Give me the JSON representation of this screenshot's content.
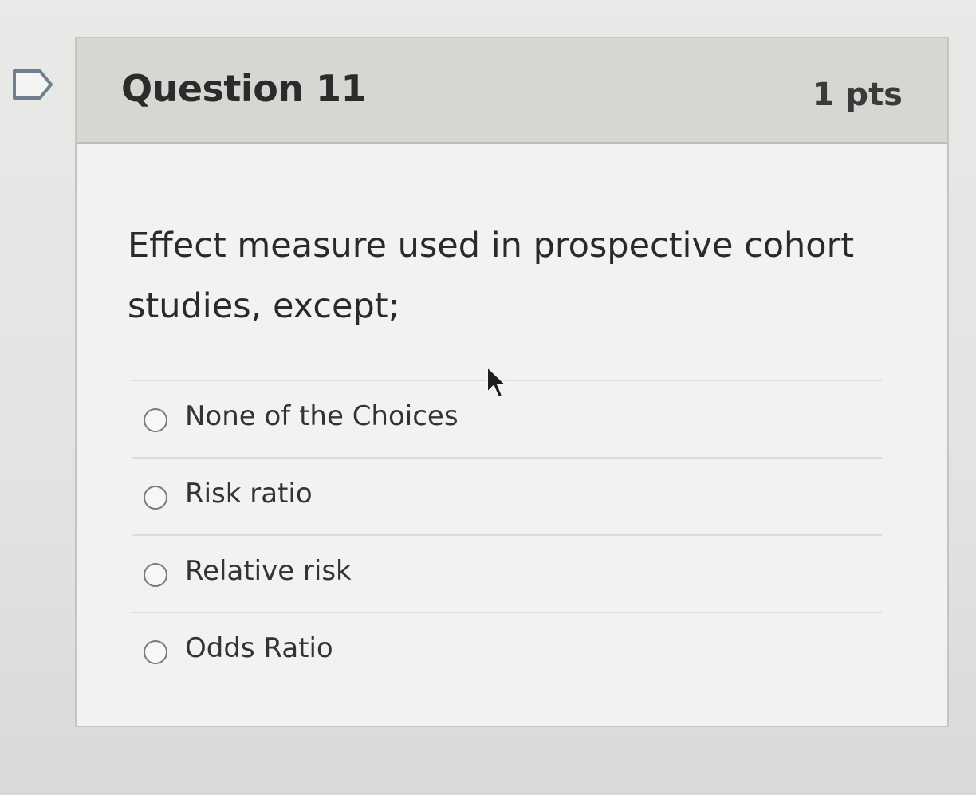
{
  "question": {
    "title": "Question 11",
    "points": "1 pts",
    "text": "Effect measure used in prospective cohort studies, except;"
  },
  "answers": [
    {
      "label": "None of the Choices",
      "selected": false
    },
    {
      "label": "Risk ratio",
      "selected": false
    },
    {
      "label": "Relative risk",
      "selected": false
    },
    {
      "label": "Odds Ratio",
      "selected": false
    }
  ],
  "icons": {
    "flag": "flag-question-icon",
    "cursor": "mouse-pointer-icon"
  }
}
